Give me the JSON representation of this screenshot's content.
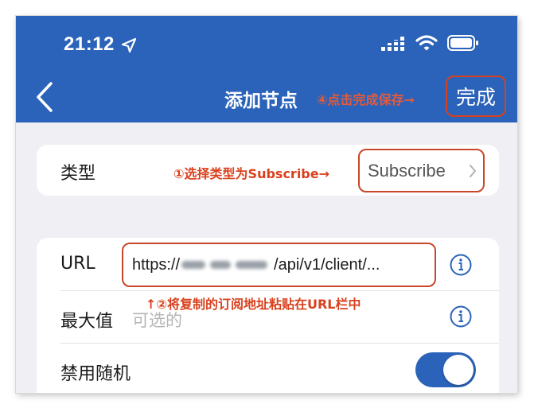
{
  "status_bar": {
    "time": "21:12"
  },
  "nav": {
    "back_icon": "chevron-left-icon",
    "title": "添加节点",
    "done_label": "完成"
  },
  "annotations": {
    "step4": "④点击完成保存→",
    "step1": "①选择类型为Subscribe→",
    "step2": "↑②将复制的订阅地址粘贴在URL栏中"
  },
  "type_row": {
    "label": "类型",
    "value": "Subscribe"
  },
  "url_row": {
    "label": "URL",
    "value_prefix": "https://",
    "value_suffix": "/api/v1/client/..."
  },
  "max_row": {
    "label": "最大值",
    "placeholder": "可选的"
  },
  "random_row": {
    "label": "禁用随机",
    "toggle_on": true
  },
  "colors": {
    "header": "#2a63b9",
    "annotation": "#d9411e",
    "toggle": "#2a63b9",
    "info": "#2a63b9"
  }
}
